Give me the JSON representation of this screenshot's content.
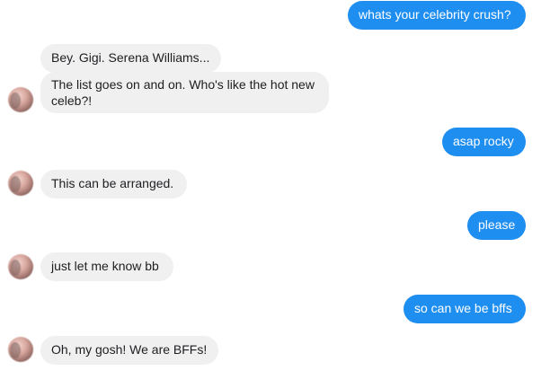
{
  "conversation": {
    "messages": [
      {
        "sender": "me",
        "text": "whats your celebrity crush?"
      },
      {
        "sender": "them",
        "text": "Bey. Gigi. Serena Williams..."
      },
      {
        "sender": "them",
        "text": "The list goes on and on. Who's like the hot new celeb?!"
      },
      {
        "sender": "me",
        "text": "asap rocky"
      },
      {
        "sender": "them",
        "text": "This can be arranged."
      },
      {
        "sender": "me",
        "text": "please"
      },
      {
        "sender": "them",
        "text": "just let me know bb"
      },
      {
        "sender": "me",
        "text": "so can we be bffs"
      },
      {
        "sender": "them",
        "text": "Oh, my gosh! We are BFFs!"
      }
    ]
  },
  "colors": {
    "outgoing_bubble": "#1f8ef1",
    "incoming_bubble": "#f1f0f0",
    "incoming_text": "#1c1e21",
    "background": "#ffffff"
  },
  "icons": {
    "contact_avatar": "contact-avatar"
  }
}
